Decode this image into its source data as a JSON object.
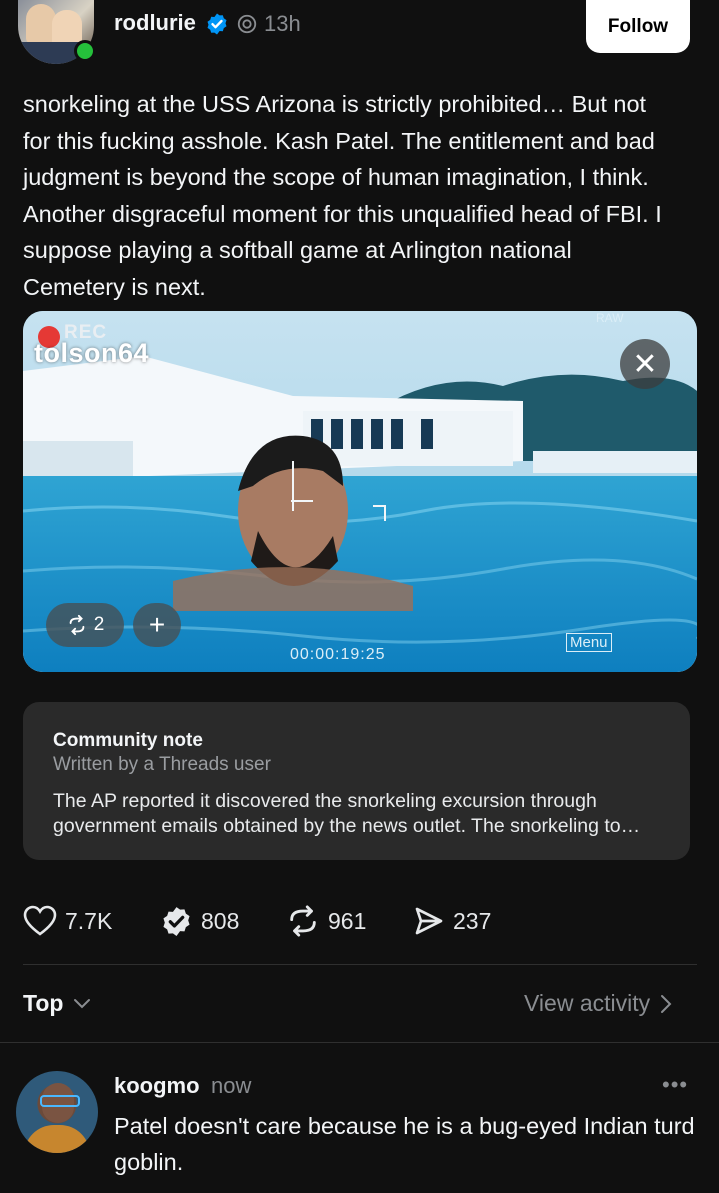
{
  "post": {
    "username": "rodlurie",
    "time": "13h",
    "follow_label": "Follow",
    "text": "snorkeling at the USS Arizona is strictly prohibited… But not for this fucking asshole. Kash Patel. The entitlement and bad judgment is beyond the scope of human imagination, I think. Another disgraceful moment for this unqualified head of FBI.  I suppose playing a softball game at Arlington national Cemetery is next."
  },
  "media": {
    "watermark": "tolson64",
    "rec_label": "REC",
    "raw_label": "RAW",
    "timecode": "00:00:19:25",
    "menu_label": "Menu",
    "repost_count": "2",
    "add_label": "+",
    "close_label": "✕"
  },
  "community_note": {
    "title": "Community note",
    "subtitle": "Written by a Threads user",
    "body": "The AP reported it discovered the snorkeling excursion through government emails obtained by the news outlet. The snorkeling to…"
  },
  "actions": {
    "likes": "7.7K",
    "quotes": "808",
    "reposts": "961",
    "shares": "237"
  },
  "sort": {
    "label": "Top",
    "view_activity": "View activity"
  },
  "reply": {
    "username": "koogmo",
    "time": "now",
    "more": "•••",
    "text": "Patel doesn't care because he is a bug-eyed Indian turd goblin."
  },
  "colors": {
    "background": "#101010",
    "verified": "#0095f6",
    "online": "#25c03b",
    "card": "#2a2a2a",
    "muted": "#8a8d91"
  }
}
